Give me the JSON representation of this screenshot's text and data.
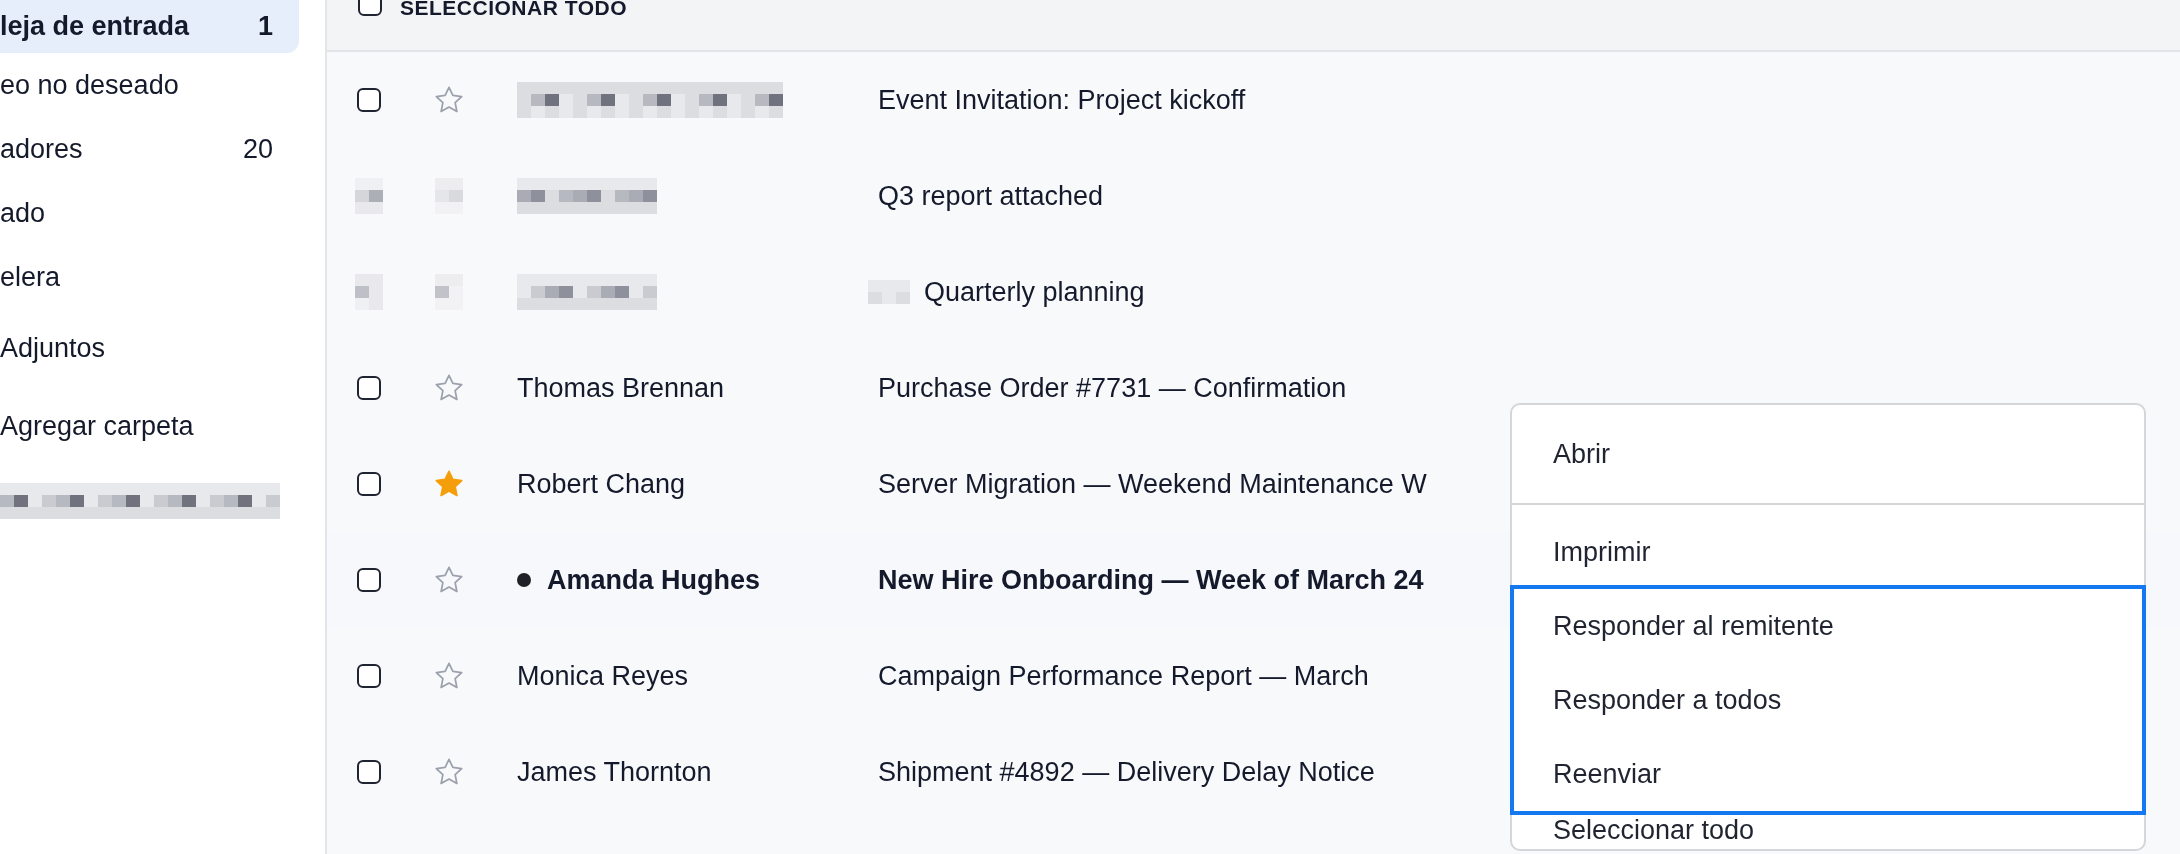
{
  "sidebar": {
    "items": [
      {
        "label": "leja de entrada",
        "count": "1",
        "selected": true
      },
      {
        "label": "eo no deseado",
        "selected": false
      },
      {
        "label": "adores",
        "count": "20",
        "selected": false
      },
      {
        "label": "ado",
        "selected": false
      },
      {
        "label": "elera",
        "selected": false
      },
      {
        "label": "Adjuntos",
        "selected": false
      },
      {
        "label": "Agregar carpeta",
        "selected": false
      }
    ]
  },
  "list": {
    "select_all": {
      "label": "SELECCIONAR TODO",
      "checked": false
    },
    "rows": [
      {
        "kind": "hidden_sender",
        "checked": false,
        "starred": false,
        "unread": false,
        "subject": "Event Invitation: Project kickoff"
      },
      {
        "kind": "masked",
        "subject": "Q3 report attached"
      },
      {
        "kind": "masked_prefix",
        "subject": "Quarterly planning"
      },
      {
        "kind": "message",
        "checked": false,
        "starred": false,
        "unread": false,
        "sender": "Thomas Brennan",
        "subject": "Purchase Order #7731 — Confirmation"
      },
      {
        "kind": "message",
        "checked": false,
        "starred": true,
        "unread": false,
        "sender": "Robert Chang",
        "subject": "Server Migration — Weekend Maintenance W"
      },
      {
        "kind": "message",
        "checked": false,
        "starred": false,
        "unread": true,
        "sender": "Amanda Hughes",
        "subject": "New Hire Onboarding — Week of March 24"
      },
      {
        "kind": "message",
        "checked": false,
        "starred": false,
        "unread": false,
        "sender": "Monica Reyes",
        "subject": "Campaign Performance Report — March"
      },
      {
        "kind": "message",
        "checked": false,
        "starred": false,
        "unread": false,
        "sender": "James Thornton",
        "subject": "Shipment #4892 — Delivery Delay Notice"
      }
    ]
  },
  "context_menu": {
    "items": [
      {
        "label": "Abrir",
        "focused": false,
        "divider_after": true
      },
      {
        "label": "Imprimir",
        "focused": false,
        "divider_after": false
      },
      {
        "label": "Responder al remitente",
        "focused": true,
        "divider_after": false
      },
      {
        "label": "Responder a todos",
        "focused": true,
        "divider_after": false
      },
      {
        "label": "Reenviar",
        "focused": true,
        "divider_after": false
      },
      {
        "label": "Seleccionar todo",
        "focused": false,
        "divider_after": false
      }
    ]
  }
}
